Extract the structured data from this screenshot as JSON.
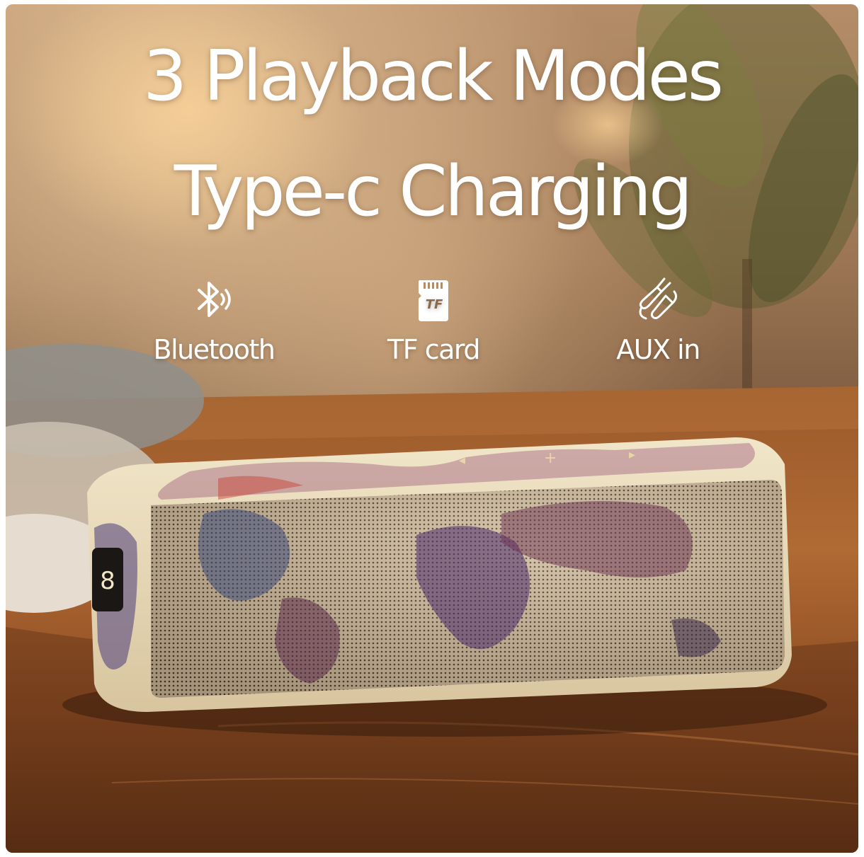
{
  "headline": {
    "line1": "3 Playback Modes",
    "line2": "Type-c Charging"
  },
  "modes": [
    {
      "label": "Bluetooth",
      "icon": "bluetooth-icon"
    },
    {
      "label": "TF card",
      "icon": "tf-card-icon",
      "icon_text": "TF"
    },
    {
      "label": "AUX in",
      "icon": "aux-cable-icon"
    }
  ],
  "colors": {
    "text": "#ffffff",
    "table_wood": "#a5622f",
    "background_wall": "#9c7654",
    "plant_green": "#56652d",
    "speaker_body": "#e8dcc0",
    "speaker_grille": "#c9b69a"
  }
}
